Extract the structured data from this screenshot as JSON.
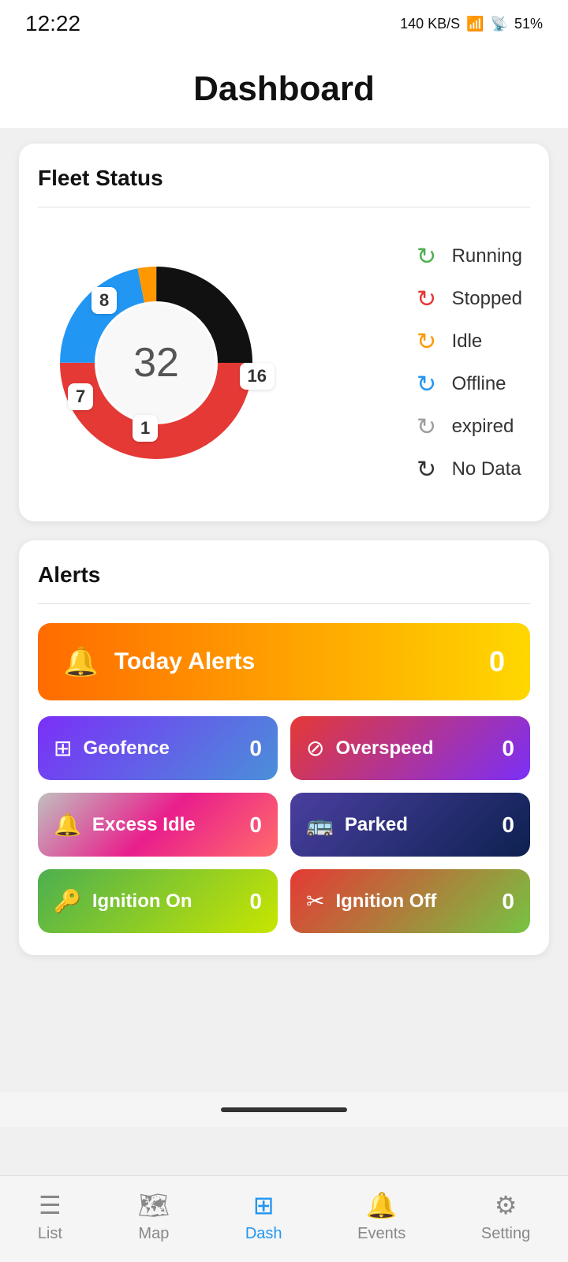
{
  "statusBar": {
    "time": "12:22",
    "networkSpeed": "140 KB/S",
    "battery": "51%"
  },
  "header": {
    "title": "Dashboard"
  },
  "fleetStatus": {
    "title": "Fleet Status",
    "total": "32",
    "segments": [
      {
        "label": "8",
        "color": "#111111",
        "id": "black"
      },
      {
        "label": "16",
        "color": "#e53935",
        "id": "red"
      },
      {
        "label": "7",
        "color": "#2196f3",
        "id": "blue"
      },
      {
        "label": "1",
        "color": "#ff9800",
        "id": "orange"
      }
    ],
    "legend": [
      {
        "id": "running",
        "label": "Running",
        "colorClass": "icon-running"
      },
      {
        "id": "stopped",
        "label": "Stopped",
        "colorClass": "icon-stopped"
      },
      {
        "id": "idle",
        "label": "Idle",
        "colorClass": "icon-idle"
      },
      {
        "id": "offline",
        "label": "Offline",
        "colorClass": "icon-offline"
      },
      {
        "id": "expired",
        "label": "expired",
        "colorClass": "icon-expired"
      },
      {
        "id": "nodata",
        "label": "No Data",
        "colorClass": "icon-nodata"
      }
    ]
  },
  "alerts": {
    "title": "Alerts",
    "todayAlerts": {
      "label": "Today Alerts",
      "count": "0"
    },
    "items": [
      {
        "id": "geofence",
        "label": "Geofence",
        "count": "0",
        "icon": "⊞",
        "btnClass": "btn-geofence"
      },
      {
        "id": "overspeed",
        "label": "Overspeed",
        "count": "0",
        "icon": "⊘",
        "btnClass": "btn-overspeed"
      },
      {
        "id": "excessidle",
        "label": "Excess Idle",
        "count": "0",
        "icon": "🔔",
        "btnClass": "btn-excessidle"
      },
      {
        "id": "parked",
        "label": "Parked",
        "count": "0",
        "icon": "🚌",
        "btnClass": "btn-parked"
      },
      {
        "id": "ignitionon",
        "label": "Ignition On",
        "count": "0",
        "icon": "🔑",
        "btnClass": "btn-ignitionon"
      },
      {
        "id": "ignitionoff",
        "label": "Ignition Off",
        "count": "0",
        "icon": "✂",
        "btnClass": "btn-ignitionoff"
      }
    ]
  },
  "bottomNav": {
    "items": [
      {
        "id": "list",
        "label": "List",
        "icon": "≡",
        "active": false
      },
      {
        "id": "map",
        "label": "Map",
        "icon": "🗺",
        "active": false
      },
      {
        "id": "dash",
        "label": "Dash",
        "icon": "⊞",
        "active": true
      },
      {
        "id": "events",
        "label": "Events",
        "icon": "🔔",
        "active": false
      },
      {
        "id": "setting",
        "label": "Setting",
        "icon": "⚙",
        "active": false
      }
    ]
  }
}
